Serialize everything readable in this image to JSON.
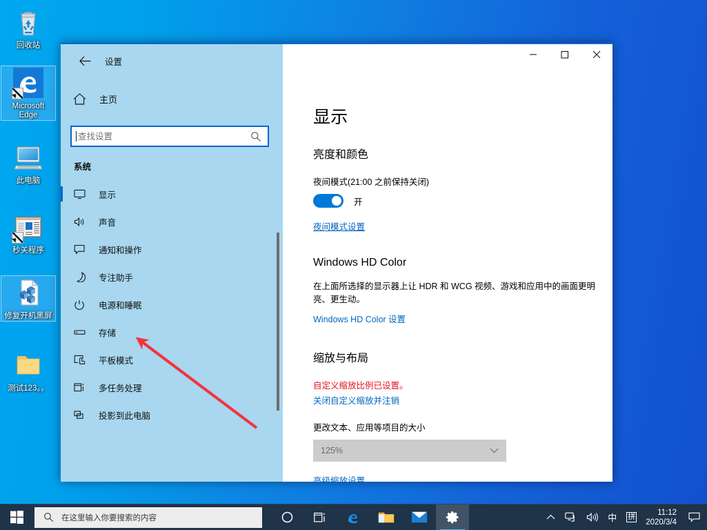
{
  "desktop": {
    "icons": [
      {
        "name": "recycle-bin",
        "label": "回收站",
        "selected": false,
        "shortcut": false
      },
      {
        "name": "microsoft-edge",
        "label": "Microsoft Edge",
        "selected": true,
        "shortcut": true
      },
      {
        "name": "this-pc",
        "label": "此电脑",
        "selected": false,
        "shortcut": false
      },
      {
        "name": "quick-close-program",
        "label": "秒关程序",
        "selected": false,
        "shortcut": true
      },
      {
        "name": "fix-boot-black-screen",
        "label": "修复开机黑屏",
        "selected": true,
        "shortcut": false
      },
      {
        "name": "test-folder",
        "label": "测试123。。",
        "selected": false,
        "shortcut": false
      }
    ]
  },
  "window": {
    "title": "设置",
    "back_icon": "back-arrow-icon",
    "minimize_label": "—",
    "maximize_label": "□",
    "close_label": "✕"
  },
  "sidebar": {
    "home_label": "主页",
    "home_icon": "home-icon",
    "search": {
      "placeholder": "查找设置",
      "value": "",
      "icon": "search-icon"
    },
    "group_label": "系统",
    "items": [
      {
        "label": "显示",
        "icon": "monitor-icon",
        "active": true
      },
      {
        "label": "声音",
        "icon": "speaker-icon",
        "active": false
      },
      {
        "label": "通知和操作",
        "icon": "notification-icon",
        "active": false
      },
      {
        "label": "专注助手",
        "icon": "moon-icon",
        "active": false
      },
      {
        "label": "电源和睡眠",
        "icon": "power-icon",
        "active": false
      },
      {
        "label": "存储",
        "icon": "storage-icon",
        "active": false
      },
      {
        "label": "平板模式",
        "icon": "tablet-icon",
        "active": false
      },
      {
        "label": "多任务处理",
        "icon": "multitask-icon",
        "active": false
      },
      {
        "label": "投影到此电脑",
        "icon": "project-icon",
        "active": false
      }
    ]
  },
  "content": {
    "page_title": "显示",
    "brightness": {
      "section_title": "亮度和颜色",
      "night_light_label": "夜间模式(21:00 之前保持关闭)",
      "toggle_state": "开",
      "toggle_on": true,
      "settings_link": "夜间模式设置"
    },
    "hdcolor": {
      "section_title": "Windows HD Color",
      "description": "在上面所选择的显示器上让 HDR 和 WCG 视频、游戏和应用中的画面更明亮、更生动。",
      "settings_link": "Windows HD Color 设置"
    },
    "scale": {
      "section_title": "缩放与布局",
      "warning": "自定义缩放比例已设置。",
      "turn_off_link": "关闭自定义缩放并注销",
      "size_label": "更改文本、应用等项目的大小",
      "scale_value": "125%",
      "dropdown_icon": "chevron-down-icon",
      "advanced_link": "高级缩放设置"
    }
  },
  "annotation": {
    "arrow_color": "#f5333f"
  },
  "taskbar": {
    "start_icon": "windows-logo-icon",
    "search_placeholder": "在这里输入你要搜索的内容",
    "search_icon": "search-icon",
    "buttons": [
      {
        "name": "cortana-button",
        "icon": "circle-icon"
      },
      {
        "name": "task-view-button",
        "icon": "task-view-icon"
      },
      {
        "name": "edge-taskbar-button",
        "icon": "edge-icon"
      },
      {
        "name": "file-explorer-button",
        "icon": "folder-icon"
      },
      {
        "name": "mail-button",
        "icon": "mail-icon"
      },
      {
        "name": "settings-button",
        "icon": "gear-icon",
        "active": true
      }
    ],
    "tray": {
      "overflow_icon": "chevron-up-icon",
      "network_icon": "network-icon",
      "volume_icon": "volume-icon",
      "ime_mode": "中",
      "ime_pinyin": "拼",
      "time": "11:12",
      "date": "2020/3/4",
      "notification_icon": "speech-bubble-icon"
    }
  },
  "colors": {
    "accent": "#0a64d2",
    "link": "#0067c0",
    "warning": "#e81123",
    "toggle_on": "#0078d7",
    "sidebar_bg": "#a8d7ef",
    "taskbar_bg": "#1f3349"
  }
}
